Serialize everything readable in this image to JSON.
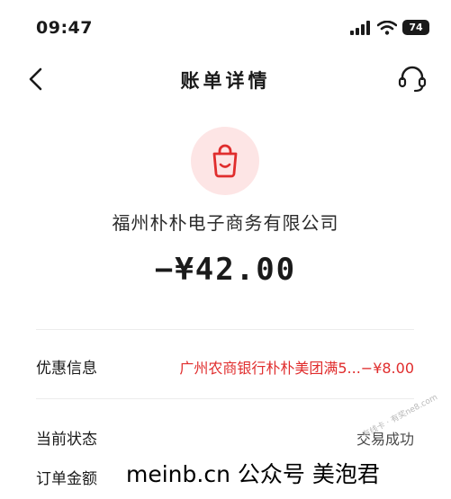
{
  "status_bar": {
    "time": "09:47",
    "battery": "74"
  },
  "nav": {
    "title": "账单详情"
  },
  "merchant": {
    "name": "福州朴朴电子商务有限公司",
    "amount": "−¥42.00"
  },
  "rows": [
    {
      "label": "优惠信息",
      "value": "广州农商银行朴朴美团满5...−¥8.00"
    },
    {
      "label": "当前状态",
      "value": "交易成功"
    },
    {
      "label": "订单金额",
      "value": ""
    }
  ],
  "watermark": {
    "diagonal": "有线卡 · 有奖ne8.com",
    "text": "meinb.cn  公众号 美泡君"
  },
  "colors": {
    "accent": "#e02d2d",
    "icon_bg": "#fde5e5"
  }
}
